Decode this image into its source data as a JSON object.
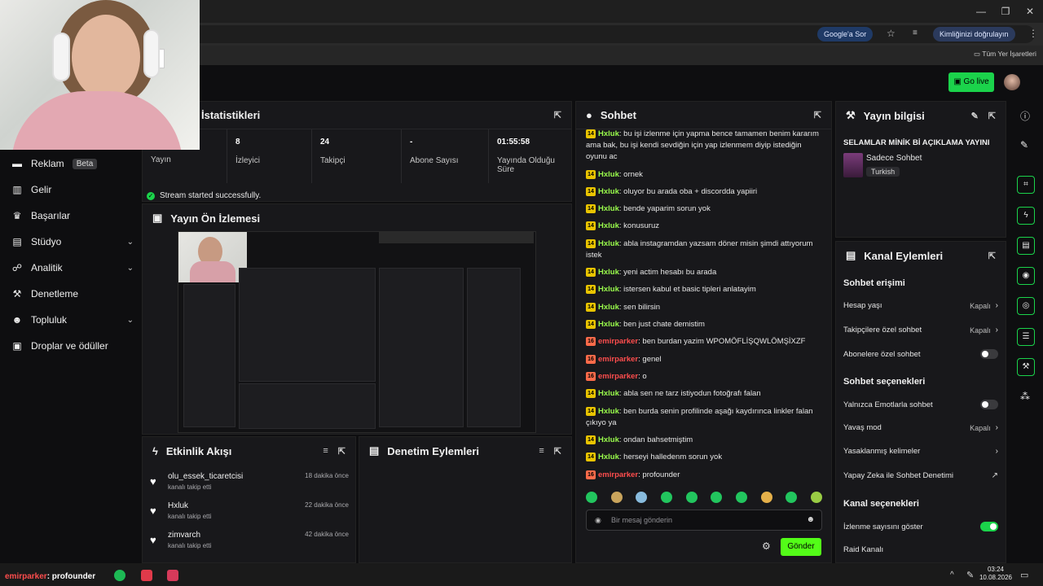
{
  "browser": {
    "google_chip": "Google'a Sor",
    "identity_chip": "Kimliğinizi doğrulayın",
    "bookmarks": "Tüm Yer İşaretleri"
  },
  "topnav": {
    "go_live": "Go live"
  },
  "sidebar": {
    "items": [
      {
        "label": "Reklam",
        "badge": "Beta",
        "icon": "megaphone-icon"
      },
      {
        "label": "Gelir",
        "icon": "chart-icon"
      },
      {
        "label": "Başarılar",
        "icon": "trophy-icon"
      },
      {
        "label": "Stüdyo",
        "icon": "studio-icon"
      },
      {
        "label": "Analitik",
        "icon": "analytics-icon"
      },
      {
        "label": "Denetleme",
        "icon": "wrench-icon"
      },
      {
        "label": "Topluluk",
        "icon": "community-icon"
      },
      {
        "label": "Droplar ve ödüller",
        "icon": "gift-icon"
      }
    ]
  },
  "stats": {
    "title": "İstatistikleri",
    "cells": [
      {
        "value": "",
        "label": "Yayın"
      },
      {
        "value": "8",
        "label": "İzleyici"
      },
      {
        "value": "24",
        "label": "Takipçi"
      },
      {
        "value": "-",
        "label": "Abone Sayısı"
      },
      {
        "value": "01:55:58",
        "label": "Yayında Olduğu Süre"
      }
    ],
    "status": "Stream started successfully."
  },
  "preview": {
    "title": "Yayın Ön İzlemesi"
  },
  "activity": {
    "title": "Etkinlik Akışı",
    "items": [
      {
        "name": "olu_essek_ticaretcisi",
        "sub": "kanalı takip etti",
        "time": "18 dakika önce"
      },
      {
        "name": "Hxluk",
        "sub": "kanalı takip etti",
        "time": "22 dakika önce"
      },
      {
        "name": "zimvarch",
        "sub": "kanalı takip etti",
        "time": "42 dakika önce"
      }
    ]
  },
  "modactions": {
    "title": "Denetim Eylemleri"
  },
  "chat": {
    "title": "Sohbet",
    "messages": [
      {
        "badge": "14",
        "user": "Hxluk",
        "text": "bu işi izlenme için yapma bence tamamen benim kararım ama bak, bu işi kendi sevdiğin için yap izlenmem diyip istediğin oyunu ac"
      },
      {
        "badge": "14",
        "user": "Hxluk",
        "text": "ornek"
      },
      {
        "badge": "14",
        "user": "Hxluk",
        "text": "oluyor bu arada oba + discordda yapiiri"
      },
      {
        "badge": "14",
        "user": "Hxluk",
        "text": "bende yaparim sorun yok"
      },
      {
        "badge": "14",
        "user": "Hxluk",
        "text": "konusuruz"
      },
      {
        "badge": "14",
        "user": "Hxluk",
        "text": "abla instagramdan yazsam döner misin şimdi attıyorum istek"
      },
      {
        "badge": "14",
        "user": "Hxluk",
        "text": "yeni actim hesabı bu arada"
      },
      {
        "badge": "14",
        "user": "Hxluk",
        "text": "istersen kabul et basic tipleri anlatayim"
      },
      {
        "badge": "14",
        "user": "Hxluk",
        "text": "sen bilirsin"
      },
      {
        "badge": "14",
        "user": "Hxluk",
        "text": "ben just chate demistim"
      },
      {
        "badge": "16",
        "user": "emirparker",
        "text": "ben burdan yazim WPOMÖFLİŞQWLÖMŞİXZF"
      },
      {
        "badge": "16",
        "user": "emirparker",
        "text": "genel"
      },
      {
        "badge": "16",
        "user": "emirparker",
        "text": "o"
      },
      {
        "badge": "14",
        "user": "Hxluk",
        "text": "abla sen ne tarz istiyodun fotoğrafı falan"
      },
      {
        "badge": "14",
        "user": "Hxluk",
        "text": "ben burda senin profilinde aşağı kaydırınca linkler falan çıkıyo ya"
      },
      {
        "badge": "14",
        "user": "Hxluk",
        "text": "ondan bahsetmiştim"
      },
      {
        "badge": "14",
        "user": "Hxluk",
        "text": "herseyi halledenm sorun yok"
      },
      {
        "badge": "16",
        "user": "emirparker",
        "text": "profounder"
      }
    ],
    "input_placeholder": "Bir mesaj gönderin",
    "send": "Gönder"
  },
  "streaminfo": {
    "title": "Yayın bilgisi",
    "stream_title": "SELAMLAR MİNİK Bİ AÇIKLAMA YAYINI",
    "category": "Sadece Sohbet",
    "language": "Turkish"
  },
  "channel": {
    "title": "Kanal Eylemleri",
    "sections": {
      "chat_access": "Sohbet erişimi",
      "chat_options": "Sohbet seçenekleri",
      "channel_options": "Kanal seçenekleri"
    },
    "rows": {
      "account_age": {
        "label": "Hesap yaşı",
        "value": "Kapalı"
      },
      "followers_only": {
        "label": "Takipçilere özel sohbet",
        "value": "Kapalı"
      },
      "subs_only": {
        "label": "Abonelere özel sohbet",
        "on": false
      },
      "emote_only": {
        "label": "Yalnızca Emotlarla sohbet",
        "on": false
      },
      "slow_mode": {
        "label": "Yavaş mod",
        "value": "Kapalı"
      },
      "banned_words": {
        "label": "Yasaklanmış kelimeler"
      },
      "ai_mod": {
        "label": "Yapay Zeka ile Sohbet Denetimi"
      },
      "show_viewers": {
        "label": "İzlenme sayısını göster",
        "on": true
      },
      "raid": {
        "label": "Raid Kanalı"
      }
    }
  },
  "taskbar": {
    "overlay_user": "emirparker",
    "overlay_text": ": profounder",
    "time": "03:24",
    "date": "10.08.2026"
  }
}
